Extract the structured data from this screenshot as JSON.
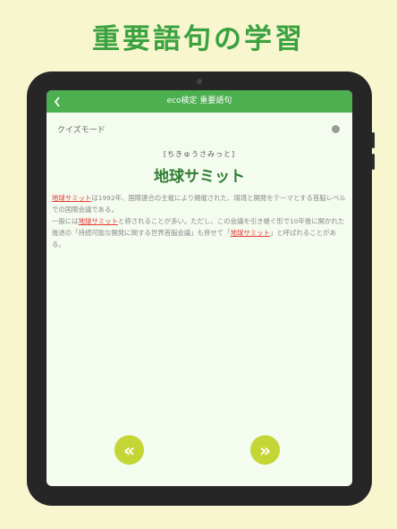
{
  "headline": "重要語句の学習",
  "navbar": {
    "title": "eco検定 重要語句",
    "back_icon": "chevron-left-icon"
  },
  "quiz": {
    "label": "クイズモード",
    "enabled": false
  },
  "entry": {
    "reading": "[ちきゅうさみっと]",
    "term": "地球サミット",
    "paragraph1": [
      {
        "text": "地球サミット",
        "link": true
      },
      {
        "text": "は1992年、国際連合の主催により開催された、環境と開発をテーマとする首脳レベルでの国際会議である。",
        "link": false
      }
    ],
    "paragraph2": [
      {
        "text": "一般には",
        "link": false
      },
      {
        "text": "地球サミット",
        "link": true
      },
      {
        "text": "と称されることが多い。ただし、この会議を引き継ぐ形で10年後に開かれた後述の「持続可能な開発に関する世界首脳会議」も併せて「",
        "link": false
      },
      {
        "text": "地球サミット",
        "link": true
      },
      {
        "text": "」と呼ばれることがある。",
        "link": false
      }
    ]
  },
  "controls": {
    "prev_label": "«",
    "next_label": "»",
    "prev_icon": "double-chevron-left-icon",
    "next_icon": "double-chevron-right-icon",
    "button_color": "#c3d636"
  },
  "colors": {
    "background": "#f8f6cf",
    "headline": "#3aa23f",
    "navbar": "#4caf50",
    "term": "#2e7d32",
    "link": "#e53935"
  }
}
